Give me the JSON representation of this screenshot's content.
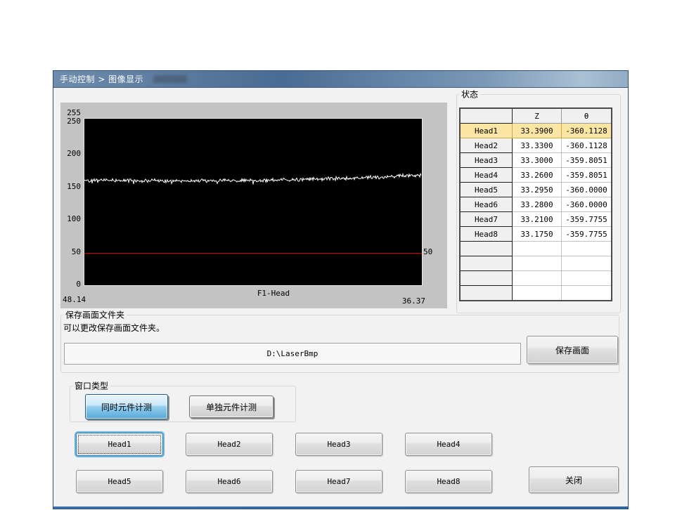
{
  "window": {
    "title": "手动控制 > 图像显示"
  },
  "chart": {
    "yticks": [
      "255",
      "250",
      "200",
      "150",
      "100",
      "50",
      "0"
    ],
    "labels": {
      "x_left": "48.14",
      "x_right": "36.37",
      "x_axis": "F1-Head",
      "threshold_right": "50"
    }
  },
  "chart_data": {
    "type": "line",
    "title": "",
    "xlabel": "F1-Head",
    "x_range_labels": [
      "48.14",
      "36.37"
    ],
    "ylim": [
      0,
      255
    ],
    "yticks": [
      255,
      250,
      200,
      150,
      100,
      50,
      0
    ],
    "grid": false,
    "background": "#000000",
    "threshold_line": {
      "value": 50,
      "color": "#dd0000",
      "label": "50"
    },
    "series": [
      {
        "name": "camera-intensity-profile",
        "color": "#ffffff",
        "samples": 480,
        "seed": 42,
        "noise_amplitude": 3.2,
        "spike_chance": 0.05,
        "spike_amplitude": 9,
        "trend_points": [
          [
            0,
            161
          ],
          [
            0.3,
            159.5
          ],
          [
            0.55,
            160.5
          ],
          [
            0.8,
            164
          ],
          [
            1,
            168.5
          ]
        ]
      }
    ]
  },
  "status": {
    "label": "状态",
    "columns": [
      "",
      "Z",
      "θ"
    ],
    "rows": [
      {
        "head": "Head1",
        "z": "33.3900",
        "theta": "-360.1128",
        "highlight": true
      },
      {
        "head": "Head2",
        "z": "33.3300",
        "theta": "-360.1128",
        "highlight": false
      },
      {
        "head": "Head3",
        "z": "33.3000",
        "theta": "-359.8051",
        "highlight": false
      },
      {
        "head": "Head4",
        "z": "33.2600",
        "theta": "-359.8051",
        "highlight": false
      },
      {
        "head": "Head5",
        "z": "33.2950",
        "theta": "-360.0000",
        "highlight": false
      },
      {
        "head": "Head6",
        "z": "33.2800",
        "theta": "-360.0000",
        "highlight": false
      },
      {
        "head": "Head7",
        "z": "33.2100",
        "theta": "-359.7755",
        "highlight": false
      },
      {
        "head": "Head8",
        "z": "33.1750",
        "theta": "-359.7755",
        "highlight": false
      }
    ],
    "empty_row_count": 4
  },
  "save_section": {
    "group_label": "保存画面文件夹",
    "description": "可以更改保存画面文件夹。",
    "path_value": "D:\\LaserBmp",
    "save_button": "保存画面"
  },
  "window_type": {
    "group_label": "窗口类型",
    "simultaneous_button": "同时元件计测",
    "individual_button": "单独元件计测"
  },
  "head_buttons": [
    "Head1",
    "Head2",
    "Head3",
    "Head4",
    "Head5",
    "Head6",
    "Head7",
    "Head8"
  ],
  "close_button": "关闭"
}
